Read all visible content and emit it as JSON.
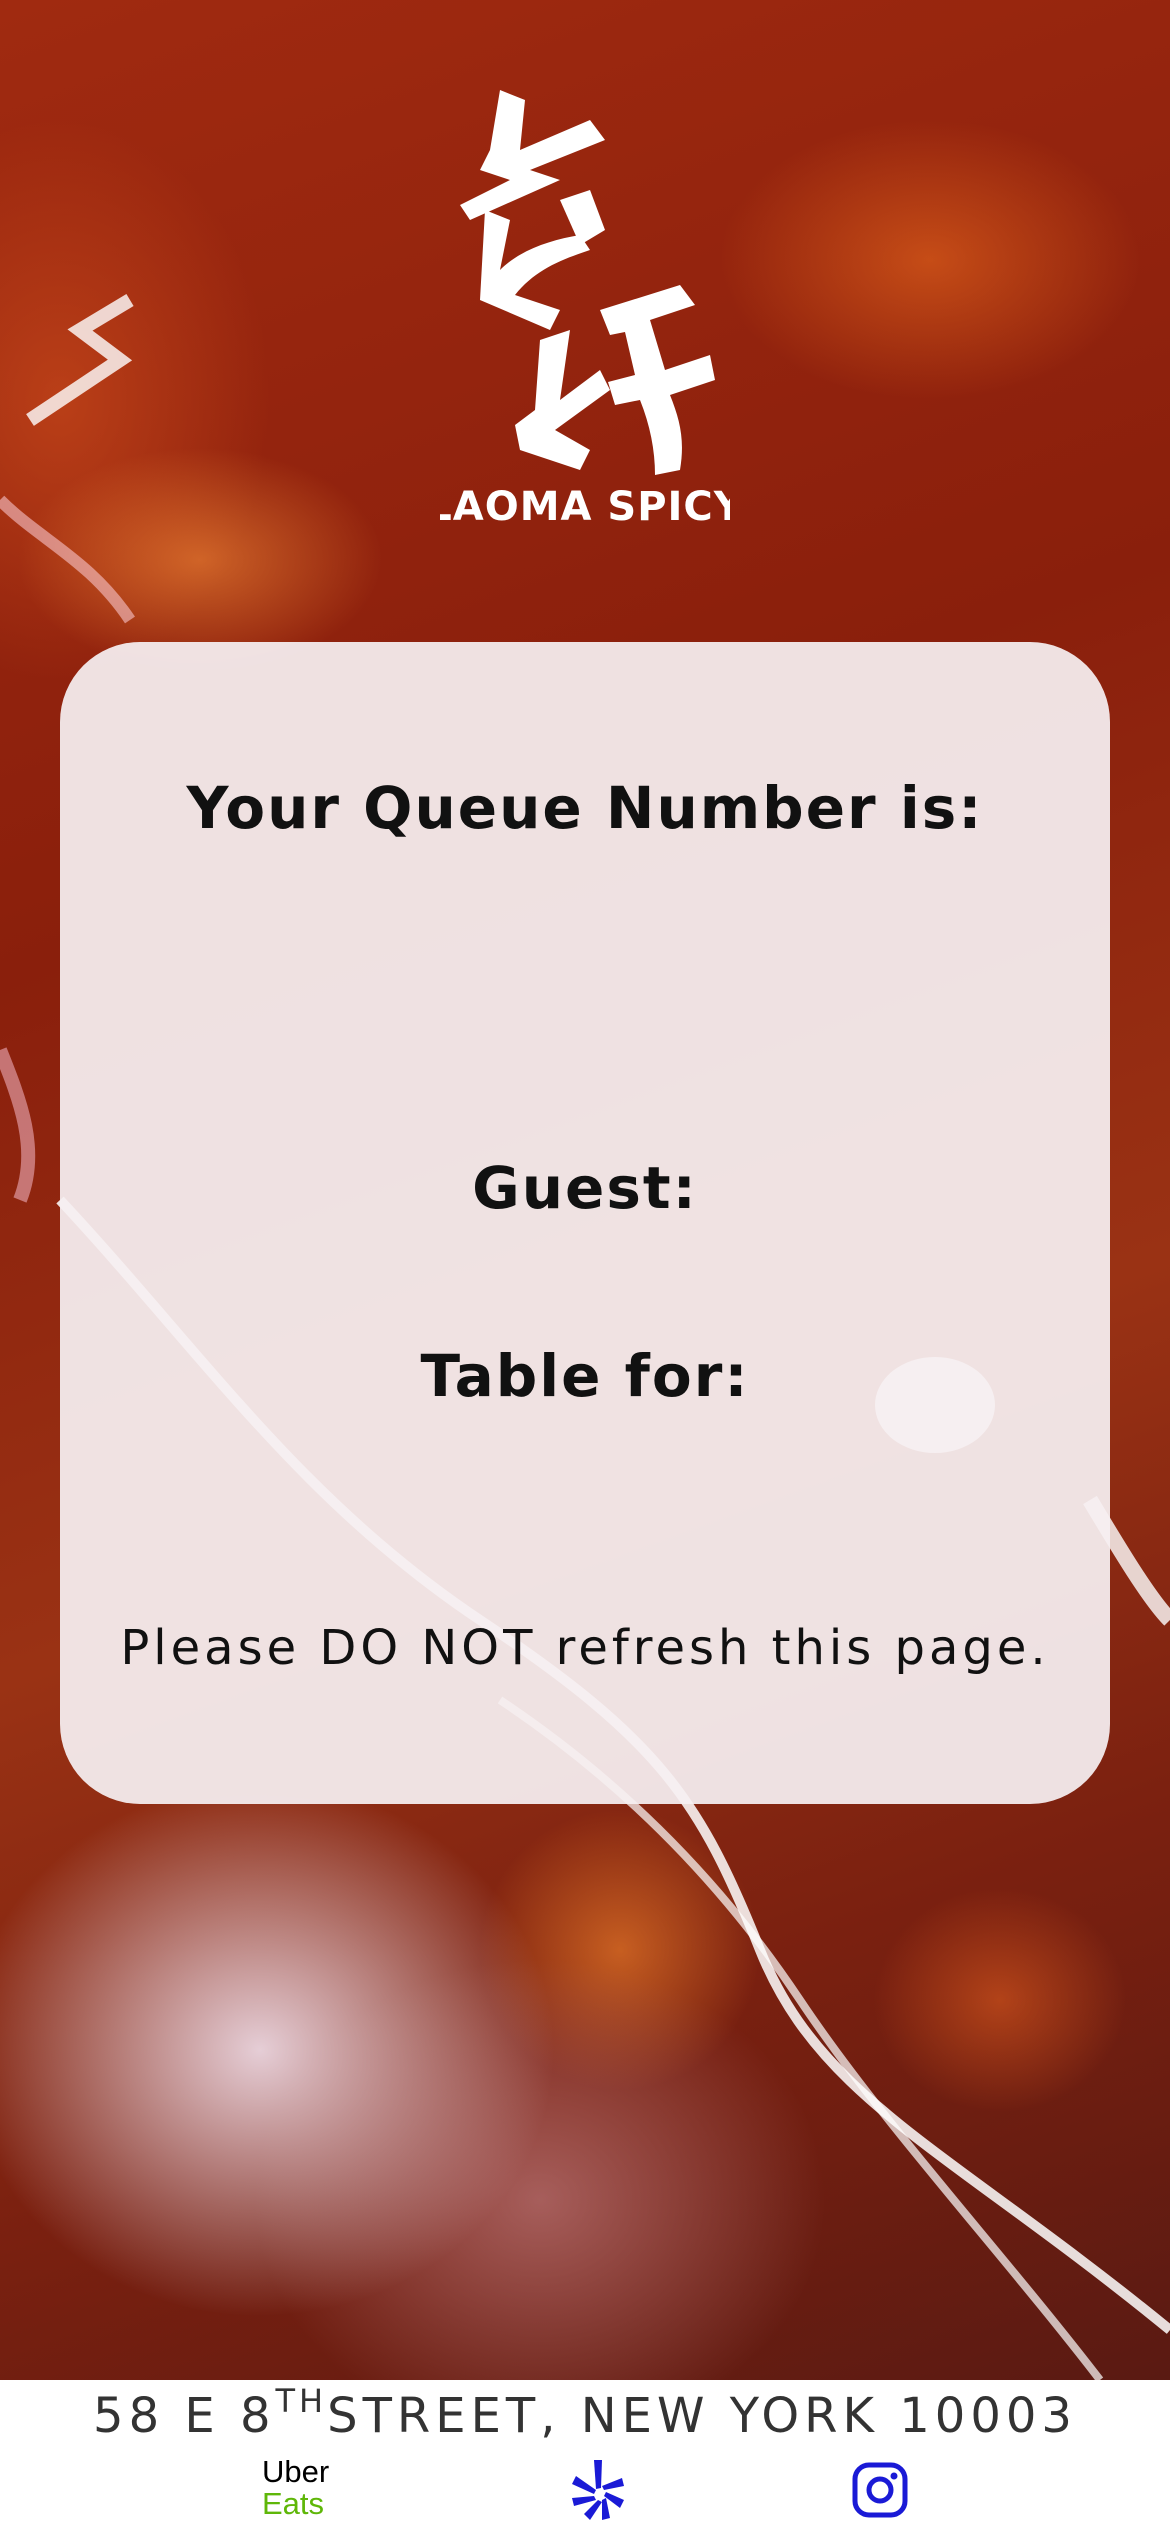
{
  "logo": {
    "text": "LAOMA SPICY",
    "chinese_glyphs": "老妈"
  },
  "queue_card": {
    "title": "Your Queue Number is:",
    "queue_number": "",
    "guest_label": "Guest:",
    "guest_value": "",
    "table_label": "Table for:",
    "table_value": "",
    "warning": "Please DO NOT refresh this page."
  },
  "footer": {
    "address_number": "58 E 8",
    "address_suffix": "TH",
    "address_rest": "STREET, NEW YORK 10003",
    "uber_eats_line1": "Uber",
    "uber_eats_line2": "Eats",
    "uber_eats_colors": [
      "#000000",
      "#5fb709"
    ],
    "yelp_icon": "yelp-burst-icon",
    "yelp_color": "#1a1ad6",
    "instagram_icon": "instagram-icon",
    "instagram_color": "#1a1ad6"
  },
  "colors": {
    "card_background": "#f6f0f2",
    "background_primary": "#8a1f0c"
  }
}
